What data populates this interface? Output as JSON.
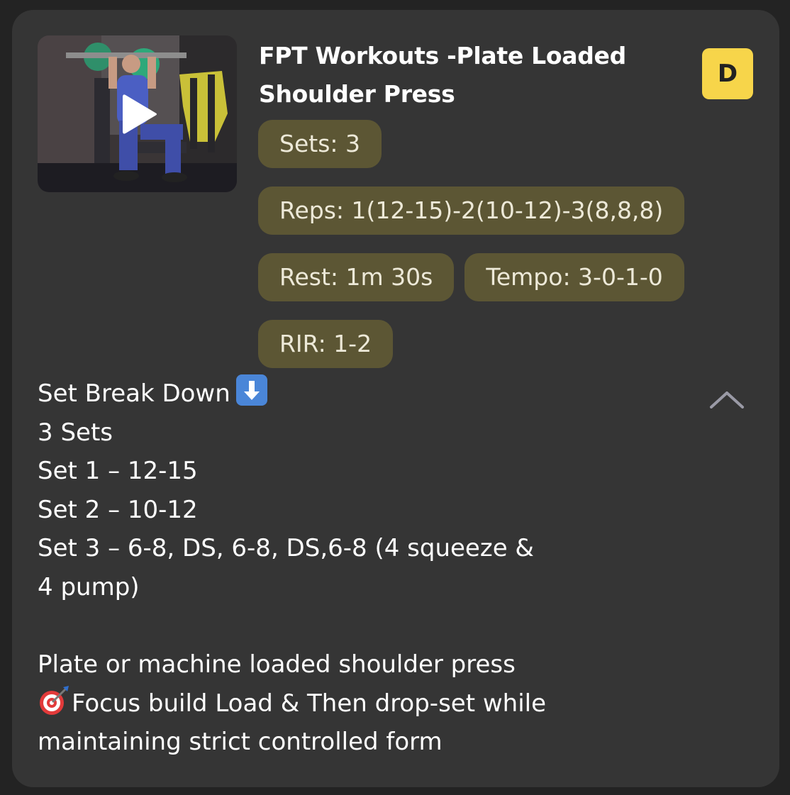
{
  "exercise": {
    "title": "FPT Workouts -Plate Loaded Shoulder Press",
    "difficulty_badge": "D",
    "thumbnail_icon": "play-icon",
    "chips": {
      "sets": "Sets: 3",
      "reps": "Reps: 1(12-15)-2(10-12)-3(8,8,8)",
      "rest": "Rest: 1m 30s",
      "tempo": "Tempo: 3-0-1-0",
      "rir": "RIR: 1-2"
    }
  },
  "description": {
    "heading": "Set Break Down",
    "heading_icon": "down-arrow-emoji-icon",
    "lines": [
      "3 Sets",
      "Set 1 – 12-15",
      "Set 2 – 10-12",
      "Set 3 – 6-8, DS, 6-8, DS,6-8 (4 squeeze &",
      "4 pump)"
    ],
    "notes": [
      "Plate or machine loaded shoulder press",
      "Focus  build Load & Then drop-set while",
      "maintaining strict controlled form"
    ],
    "focus_icon": "target-emoji-icon",
    "collapse_icon": "chevron-up-icon"
  },
  "colors": {
    "card_bg": "#353535",
    "chip_bg": "#5c5634",
    "badge_bg": "#f7d54a"
  }
}
